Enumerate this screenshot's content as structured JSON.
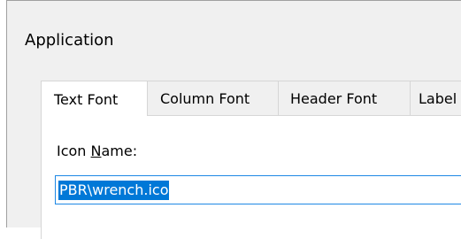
{
  "section": {
    "title": "Application"
  },
  "tabs": [
    {
      "label": "Text Font",
      "active": true
    },
    {
      "label": "Column Font",
      "active": false
    },
    {
      "label": "Header Font",
      "active": false
    },
    {
      "label": "Label",
      "active": false
    }
  ],
  "panel": {
    "field_label_prefix": "Icon ",
    "field_label_mnemonic": "N",
    "field_label_suffix": "ame:",
    "field_value": "PBR\\wrench.ico"
  },
  "colors": {
    "dialog_bg": "#f0f0f0",
    "panel_bg": "#ffffff",
    "selection_bg": "#0078d7",
    "input_border": "#1e88e5"
  }
}
